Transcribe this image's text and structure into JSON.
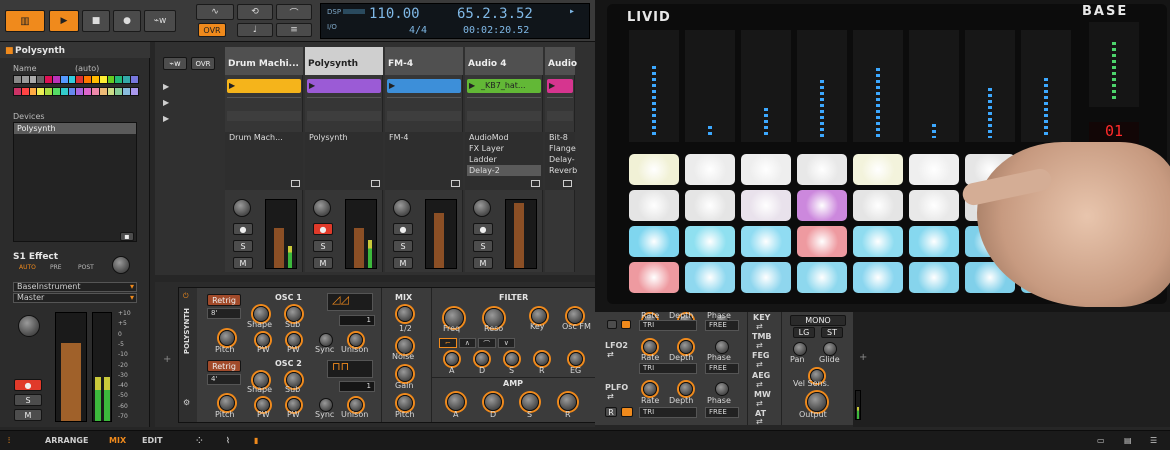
{
  "transport": {
    "tempo": "110.00",
    "position": "65.2.3.52",
    "signature": "4/4",
    "time": "00:02:20.52",
    "dsp_label": "DSP",
    "io_label": "I/O",
    "ovr_label": "OVR"
  },
  "inspector": {
    "title": "Polysynth",
    "name_label": "Name",
    "name_value": "(auto)",
    "devices_label": "Devices",
    "device": "Polysynth",
    "effect_label": "S1 Effect",
    "auto": "AUTO",
    "pre": "PRE",
    "post": "POST",
    "instrument": "BaseInstrument",
    "output": "Master",
    "meter_ticks": [
      "+10",
      "+5",
      "0",
      "-5",
      "-10",
      "-20",
      "-30",
      "-40",
      "-50",
      "-60",
      "-70"
    ]
  },
  "mixer": {
    "ovr_label": "OVR",
    "tracks": [
      {
        "name": "Drum Machi...",
        "color": "#f5b41b",
        "device": "Drum Mach..."
      },
      {
        "name": "Polysynth",
        "color": "#9b5bd6",
        "device": "Polysynth"
      },
      {
        "name": "FM-4",
        "color": "#3d8fd9",
        "device": "FM-4"
      },
      {
        "name": "Audio 4",
        "color": "#62b836",
        "device": "AudioMod",
        "clip": "_KB7_hat..."
      },
      {
        "name": "Audio",
        "color": "#d6358f",
        "device": "Bit-8"
      }
    ],
    "audio4_devices": [
      "AudioMod",
      "FX Layer",
      "Ladder",
      "Delay-2"
    ],
    "audio5_devices": [
      "Bit-8",
      "Flange",
      "Delay-",
      "Reverb"
    ],
    "s_label": "S",
    "m_label": "M"
  },
  "synth": {
    "name": "POLYSYNTH",
    "osc1": "OSC 1",
    "osc2": "OSC 2",
    "retrig": "Retrig",
    "oct1": "8'",
    "oct2": "4'",
    "shape": "Shape",
    "sub": "Sub",
    "pitch": "Pitch",
    "pw": "PW",
    "sync": "Sync",
    "unison": "Unison",
    "unison_val": "1",
    "mix": "MIX",
    "half": "1/2",
    "noise": "Noise",
    "gain": "Gain",
    "filter": "FILTER",
    "freq": "Freq",
    "reso": "Reso",
    "key": "Key",
    "oscfm": "Osc FM",
    "a": "A",
    "d": "D",
    "s": "S",
    "r": "R",
    "eg": "EG",
    "amp": "AMP"
  },
  "modpanel": {
    "rate": "Rate",
    "depth": "Depth",
    "phase": "Phase",
    "tri": "TRI",
    "free": "FREE",
    "lfo2": "LFO2",
    "plfo": "PLFO",
    "r": "R",
    "key": "KEY",
    "tmb": "TMB",
    "feg": "FEG",
    "aeg": "AEG",
    "mw": "MW",
    "at": "AT",
    "mono": "MONO",
    "lg": "LG",
    "st": "ST",
    "pan": "Pan",
    "glide": "Glide",
    "velsens": "Vel Sens.",
    "output": "Output"
  },
  "controller": {
    "brand": "LIVID",
    "model": "BASE",
    "led_display": "01"
  },
  "statusbar": {
    "arrange": "ARRANGE",
    "mix": "MIX",
    "edit": "EDIT"
  }
}
